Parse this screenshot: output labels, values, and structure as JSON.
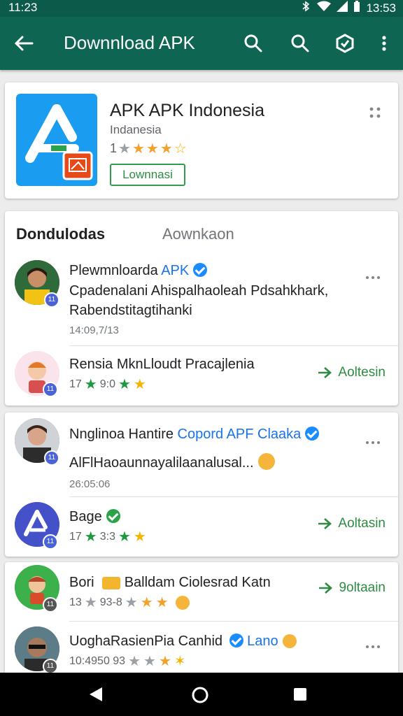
{
  "status": {
    "time": "11:23",
    "clock": "13:53"
  },
  "appbar": {
    "title": "Downnload APK"
  },
  "app": {
    "name": "APK APK Indonesia",
    "sub": "Indanesia",
    "rating": "1",
    "download_label": "Lownnasi"
  },
  "tabs": {
    "tab1": "Dondulodas",
    "tab2": "Aownkaon"
  },
  "items": [
    {
      "name": "Plewmnloarda",
      "tag": "APK",
      "desc1": "Cpadenalani Ahispalhaoleah Pdsahkhark,",
      "desc2": "Rabendstitagtihanki",
      "time": "14:09,7/13",
      "badge": "11"
    },
    {
      "name": "Rensia MknLloudt Pracajlenia",
      "rating": "17",
      "score": "9:0",
      "action": "Aoltesin",
      "badge": "11"
    },
    {
      "name": "Nnglinoa Hantire",
      "tag": "Copord APF Claaka",
      "desc1": "AlFlHaoaunnayalilaanalusal...",
      "time": "26:05:06",
      "badge": "11"
    },
    {
      "name": "Bage",
      "rating": "17",
      "score": "3:3",
      "action": "Aoltasin",
      "badge": "11"
    },
    {
      "name": "Bori",
      "tag": "Balldam Ciolesrad Katn",
      "rating": "13",
      "score": "93-8",
      "action": "9oltaain",
      "badge": "11"
    },
    {
      "name": "UoghaRasienPia Canhid",
      "tag": "Lano",
      "rating": "10:4950 93",
      "badge": "11"
    }
  ],
  "colors": {
    "appbar": "#0d6552",
    "status": "#0b5a4a",
    "accent_green": "#2e8b43",
    "link_blue": "#1a73e8"
  }
}
